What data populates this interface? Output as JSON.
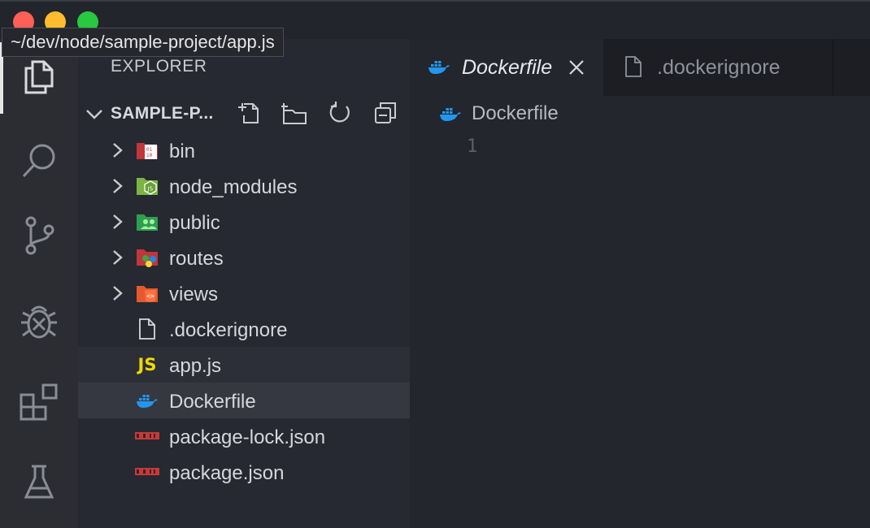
{
  "window": {
    "path_tooltip": "~/dev/node/sample-project/app.js",
    "traffic_lights": {
      "close": "#fe5f57",
      "minimize": "#febc2e",
      "zoom": "#28c840"
    }
  },
  "activity_bar": {
    "items": [
      {
        "icon": "files-icon",
        "active": true
      },
      {
        "icon": "search-icon",
        "active": false
      },
      {
        "icon": "source-control-icon",
        "active": false
      },
      {
        "icon": "debug-icon",
        "active": false
      },
      {
        "icon": "extensions-icon",
        "active": false
      },
      {
        "icon": "testing-icon",
        "active": false
      }
    ]
  },
  "sidebar": {
    "title": "EXPLORER",
    "section": {
      "name": "SAMPLE-P...",
      "actions": [
        "new-file-icon",
        "new-folder-icon",
        "refresh-icon",
        "collapse-all-icon"
      ]
    },
    "tree": [
      {
        "label": "bin",
        "type": "folder",
        "icon": "folder-bin-icon"
      },
      {
        "label": "node_modules",
        "type": "folder",
        "icon": "folder-node-icon"
      },
      {
        "label": "public",
        "type": "folder",
        "icon": "folder-public-icon"
      },
      {
        "label": "routes",
        "type": "folder",
        "icon": "folder-routes-icon"
      },
      {
        "label": "views",
        "type": "folder",
        "icon": "folder-views-icon"
      },
      {
        "label": ".dockerignore",
        "type": "file",
        "icon": "file-icon"
      },
      {
        "label": "app.js",
        "type": "file",
        "icon": "javascript-icon",
        "icon_text": "JS",
        "state": "hover"
      },
      {
        "label": "Dockerfile",
        "type": "file",
        "icon": "docker-icon",
        "state": "selected"
      },
      {
        "label": "package-lock.json",
        "type": "file",
        "icon": "npm-icon"
      },
      {
        "label": "package.json",
        "type": "file",
        "icon": "npm-icon"
      }
    ]
  },
  "editor": {
    "tabs": [
      {
        "label": "Dockerfile",
        "icon": "docker-icon",
        "active": true
      },
      {
        "label": ".dockerignore",
        "icon": "file-icon",
        "active": false
      }
    ],
    "breadcrumb": "Dockerfile",
    "line_numbers": [
      "1"
    ]
  },
  "colors": {
    "docker": "#2496ed",
    "js": "#f1d900",
    "npm": "#cb3837",
    "accent_text": "#d5d7dc"
  }
}
